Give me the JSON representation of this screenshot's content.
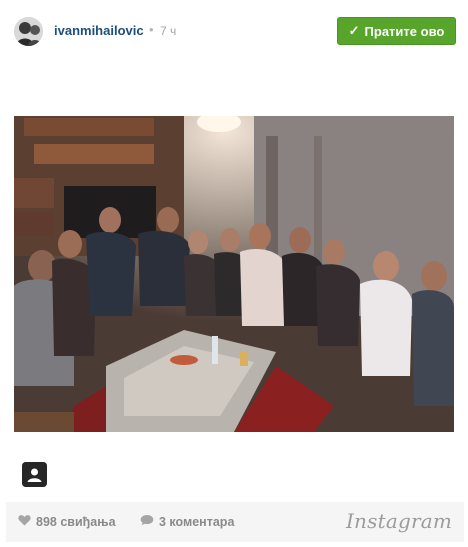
{
  "header": {
    "username": "ivanmihailovic",
    "separator": "•",
    "time": "7 ч",
    "follow_label": "Пратите ово",
    "follow_icon": "check-icon"
  },
  "post": {
    "photo_description_icon": "group-photo",
    "user_tag_icon": "user-tag-icon"
  },
  "footer": {
    "likes": "898 свиђања",
    "likes_icon": "heart-icon",
    "comments": "3 коментара",
    "comments_icon": "comment-bubble-icon",
    "brand": "Instagram"
  },
  "colors": {
    "follow_button": "#58a52c",
    "username": "#1d4e7c",
    "footer_background": "#f5f5f5",
    "meta_text": "#8a8a8a"
  }
}
